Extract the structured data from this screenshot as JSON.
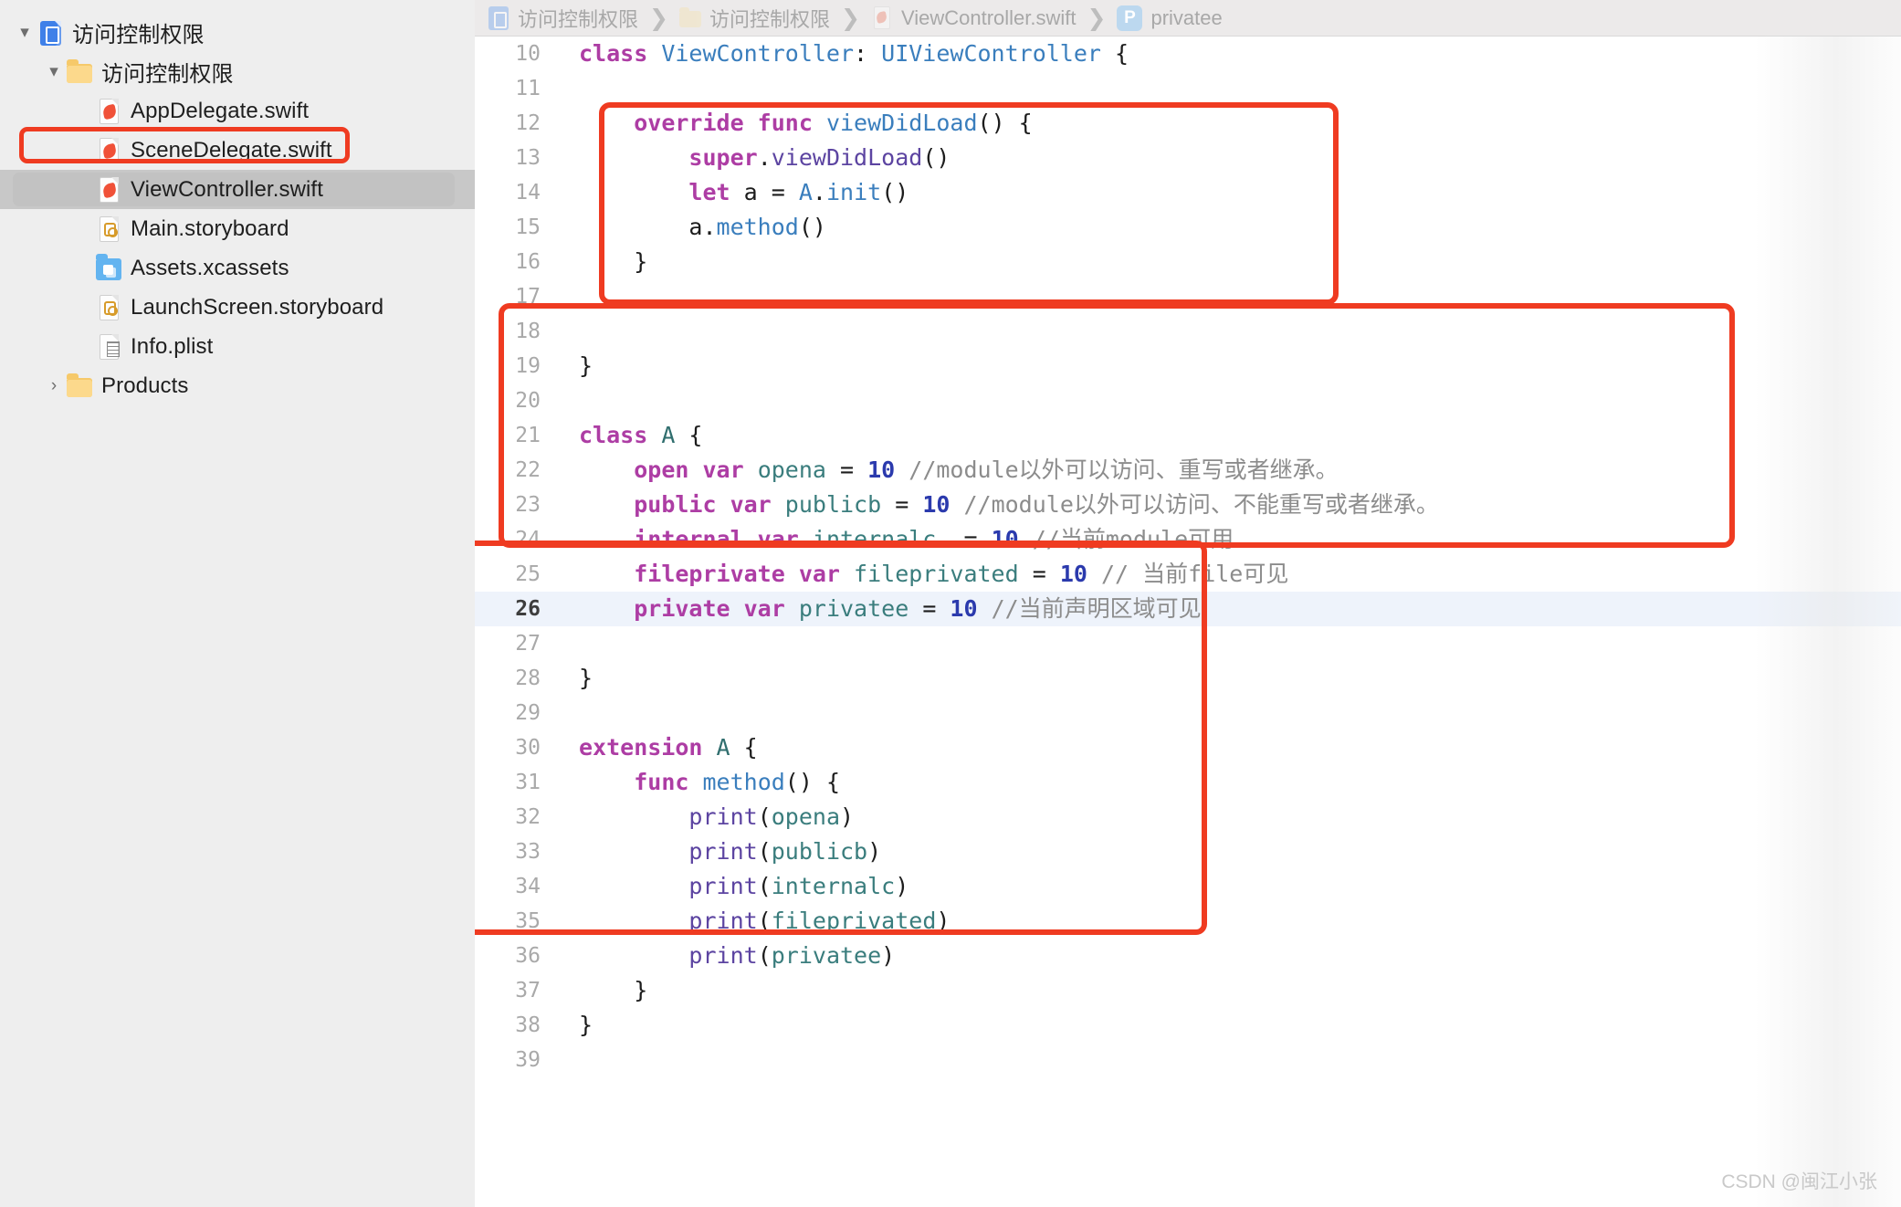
{
  "sidebar": {
    "items": [
      {
        "label": "访问控制权限",
        "icon": "xcode-project-icon",
        "indent": 0,
        "twisty": "▾",
        "kind": "project",
        "selected": false
      },
      {
        "label": "访问控制权限",
        "icon": "folder-icon",
        "indent": 1,
        "twisty": "▾",
        "kind": "folder",
        "selected": false
      },
      {
        "label": "AppDelegate.swift",
        "icon": "swift-file-icon",
        "indent": 2,
        "twisty": "",
        "kind": "swift",
        "selected": false
      },
      {
        "label": "SceneDelegate.swift",
        "icon": "swift-file-icon",
        "indent": 2,
        "twisty": "",
        "kind": "swift",
        "selected": false
      },
      {
        "label": "ViewController.swift",
        "icon": "swift-file-icon",
        "indent": 2,
        "twisty": "",
        "kind": "swift",
        "selected": true
      },
      {
        "label": "Main.storyboard",
        "icon": "storyboard-file-icon",
        "indent": 2,
        "twisty": "",
        "kind": "story",
        "selected": false
      },
      {
        "label": "Assets.xcassets",
        "icon": "assets-catalog-icon",
        "indent": 2,
        "twisty": "",
        "kind": "assets",
        "selected": false
      },
      {
        "label": "LaunchScreen.storyboard",
        "icon": "storyboard-file-icon",
        "indent": 2,
        "twisty": "",
        "kind": "story",
        "selected": false
      },
      {
        "label": "Info.plist",
        "icon": "plist-file-icon",
        "indent": 2,
        "twisty": "",
        "kind": "plist",
        "selected": false
      },
      {
        "label": "Products",
        "icon": "folder-icon",
        "indent": 1,
        "twisty": "›",
        "kind": "folder",
        "selected": false
      }
    ]
  },
  "breadcrumb": {
    "items": [
      {
        "label": "访问控制权限",
        "icon": "xcode-project-icon",
        "kind": "proj"
      },
      {
        "label": "访问控制权限",
        "icon": "folder-icon",
        "kind": "fold"
      },
      {
        "label": "ViewController.swift",
        "icon": "swift-file-icon",
        "kind": "swift"
      },
      {
        "label": "privatee",
        "icon": "property-badge-icon",
        "kind": "prop",
        "badge": "P"
      }
    ],
    "separator": "❯"
  },
  "editor": {
    "first_line": 10,
    "current_line": 26,
    "lines": [
      {
        "n": 10,
        "tokens": [
          {
            "t": "class ",
            "c": "kw"
          },
          {
            "t": "ViewController",
            "c": "type"
          },
          {
            "t": ": ",
            "c": "pl"
          },
          {
            "t": "UIViewController",
            "c": "type"
          },
          {
            "t": " {",
            "c": "pl"
          }
        ]
      },
      {
        "n": 11,
        "tokens": []
      },
      {
        "n": 12,
        "tokens": [
          {
            "t": "    ",
            "c": "pl"
          },
          {
            "t": "override func ",
            "c": "kw"
          },
          {
            "t": "viewDidLoad",
            "c": "fn"
          },
          {
            "t": "() {",
            "c": "pl"
          }
        ]
      },
      {
        "n": 13,
        "tokens": [
          {
            "t": "        ",
            "c": "pl"
          },
          {
            "t": "super",
            "c": "kw"
          },
          {
            "t": ".",
            "c": "pl"
          },
          {
            "t": "viewDidLoad",
            "c": "call"
          },
          {
            "t": "()",
            "c": "pl"
          }
        ]
      },
      {
        "n": 14,
        "tokens": [
          {
            "t": "        ",
            "c": "pl"
          },
          {
            "t": "let ",
            "c": "kw"
          },
          {
            "t": "a = ",
            "c": "pl"
          },
          {
            "t": "A",
            "c": "type"
          },
          {
            "t": ".",
            "c": "pl"
          },
          {
            "t": "init",
            "c": "fn"
          },
          {
            "t": "()",
            "c": "pl"
          }
        ]
      },
      {
        "n": 15,
        "tokens": [
          {
            "t": "        ",
            "c": "pl"
          },
          {
            "t": "a.",
            "c": "pl"
          },
          {
            "t": "method",
            "c": "fn"
          },
          {
            "t": "()",
            "c": "pl"
          }
        ]
      },
      {
        "n": 16,
        "tokens": [
          {
            "t": "    }",
            "c": "pl"
          }
        ]
      },
      {
        "n": 17,
        "tokens": []
      },
      {
        "n": 18,
        "tokens": []
      },
      {
        "n": 19,
        "tokens": [
          {
            "t": "}",
            "c": "pl"
          }
        ]
      },
      {
        "n": 20,
        "tokens": []
      },
      {
        "n": 21,
        "tokens": [
          {
            "t": "class ",
            "c": "kw"
          },
          {
            "t": "A",
            "c": "typd"
          },
          {
            "t": " {",
            "c": "pl"
          }
        ]
      },
      {
        "n": 22,
        "tokens": [
          {
            "t": "    ",
            "c": "pl"
          },
          {
            "t": "open var ",
            "c": "kw"
          },
          {
            "t": "opena",
            "c": "id"
          },
          {
            "t": " = ",
            "c": "pl"
          },
          {
            "t": "10",
            "c": "num"
          },
          {
            "t": " //module以外可以访问、重写或者继承。",
            "c": "cmt"
          }
        ]
      },
      {
        "n": 23,
        "tokens": [
          {
            "t": "    ",
            "c": "pl"
          },
          {
            "t": "public var ",
            "c": "kw"
          },
          {
            "t": "publicb",
            "c": "id"
          },
          {
            "t": " = ",
            "c": "pl"
          },
          {
            "t": "10",
            "c": "num"
          },
          {
            "t": " //module以外可以访问、不能重写或者继承。",
            "c": "cmt"
          }
        ]
      },
      {
        "n": 24,
        "tokens": [
          {
            "t": "    ",
            "c": "pl"
          },
          {
            "t": "internal var ",
            "c": "kw"
          },
          {
            "t": "internalc",
            "c": "id"
          },
          {
            "t": "  = ",
            "c": "pl"
          },
          {
            "t": "10",
            "c": "num"
          },
          {
            "t": " //当前module可用",
            "c": "cmt"
          }
        ]
      },
      {
        "n": 25,
        "tokens": [
          {
            "t": "    ",
            "c": "pl"
          },
          {
            "t": "fileprivate var ",
            "c": "kw"
          },
          {
            "t": "fileprivated",
            "c": "id"
          },
          {
            "t": " = ",
            "c": "pl"
          },
          {
            "t": "10",
            "c": "num"
          },
          {
            "t": " // 当前file可见",
            "c": "cmt"
          }
        ]
      },
      {
        "n": 26,
        "tokens": [
          {
            "t": "    ",
            "c": "pl"
          },
          {
            "t": "private var ",
            "c": "kw"
          },
          {
            "t": "privatee",
            "c": "id"
          },
          {
            "t": " = ",
            "c": "pl"
          },
          {
            "t": "10",
            "c": "num"
          },
          {
            "t": " //当前声明区域可见",
            "c": "cmt"
          }
        ]
      },
      {
        "n": 27,
        "tokens": []
      },
      {
        "n": 28,
        "tokens": [
          {
            "t": "}",
            "c": "pl"
          }
        ]
      },
      {
        "n": 29,
        "tokens": []
      },
      {
        "n": 30,
        "tokens": [
          {
            "t": "extension ",
            "c": "kw"
          },
          {
            "t": "A",
            "c": "typd"
          },
          {
            "t": " {",
            "c": "pl"
          }
        ]
      },
      {
        "n": 31,
        "tokens": [
          {
            "t": "    ",
            "c": "pl"
          },
          {
            "t": "func ",
            "c": "kw"
          },
          {
            "t": "method",
            "c": "fn"
          },
          {
            "t": "() {",
            "c": "pl"
          }
        ]
      },
      {
        "n": 32,
        "tokens": [
          {
            "t": "        ",
            "c": "pl"
          },
          {
            "t": "print",
            "c": "call"
          },
          {
            "t": "(",
            "c": "pl"
          },
          {
            "t": "opena",
            "c": "id"
          },
          {
            "t": ")",
            "c": "pl"
          }
        ]
      },
      {
        "n": 33,
        "tokens": [
          {
            "t": "        ",
            "c": "pl"
          },
          {
            "t": "print",
            "c": "call"
          },
          {
            "t": "(",
            "c": "pl"
          },
          {
            "t": "publicb",
            "c": "id"
          },
          {
            "t": ")",
            "c": "pl"
          }
        ]
      },
      {
        "n": 34,
        "tokens": [
          {
            "t": "        ",
            "c": "pl"
          },
          {
            "t": "print",
            "c": "call"
          },
          {
            "t": "(",
            "c": "pl"
          },
          {
            "t": "internalc",
            "c": "id"
          },
          {
            "t": ")",
            "c": "pl"
          }
        ]
      },
      {
        "n": 35,
        "tokens": [
          {
            "t": "        ",
            "c": "pl"
          },
          {
            "t": "print",
            "c": "call"
          },
          {
            "t": "(",
            "c": "pl"
          },
          {
            "t": "fileprivated",
            "c": "id"
          },
          {
            "t": ")",
            "c": "pl"
          }
        ]
      },
      {
        "n": 36,
        "tokens": [
          {
            "t": "        ",
            "c": "pl"
          },
          {
            "t": "print",
            "c": "call"
          },
          {
            "t": "(",
            "c": "pl"
          },
          {
            "t": "privatee",
            "c": "id"
          },
          {
            "t": ")",
            "c": "pl"
          }
        ]
      },
      {
        "n": 37,
        "tokens": [
          {
            "t": "    }",
            "c": "pl"
          }
        ]
      },
      {
        "n": 38,
        "tokens": [
          {
            "t": "}",
            "c": "pl"
          }
        ]
      },
      {
        "n": 39,
        "tokens": []
      }
    ]
  },
  "annotations": {
    "color": "#ef3b21",
    "boxes": [
      "viewdidload-block",
      "class-a-block",
      "extension-a-block",
      "sidebar-selected-file"
    ]
  },
  "watermark": {
    "text": "CSDN @闽江小张"
  },
  "colors": {
    "accent_red": "#ef3b21",
    "keyword": "#ad3da4",
    "type": "#3a7ebd",
    "identifier": "#3a7d7d",
    "number": "#2b3aad",
    "comment": "#8c8c8c",
    "call": "#5c44a1",
    "sidebar_bg": "#eeeeee",
    "current_line_bg": "#eef3fb"
  }
}
